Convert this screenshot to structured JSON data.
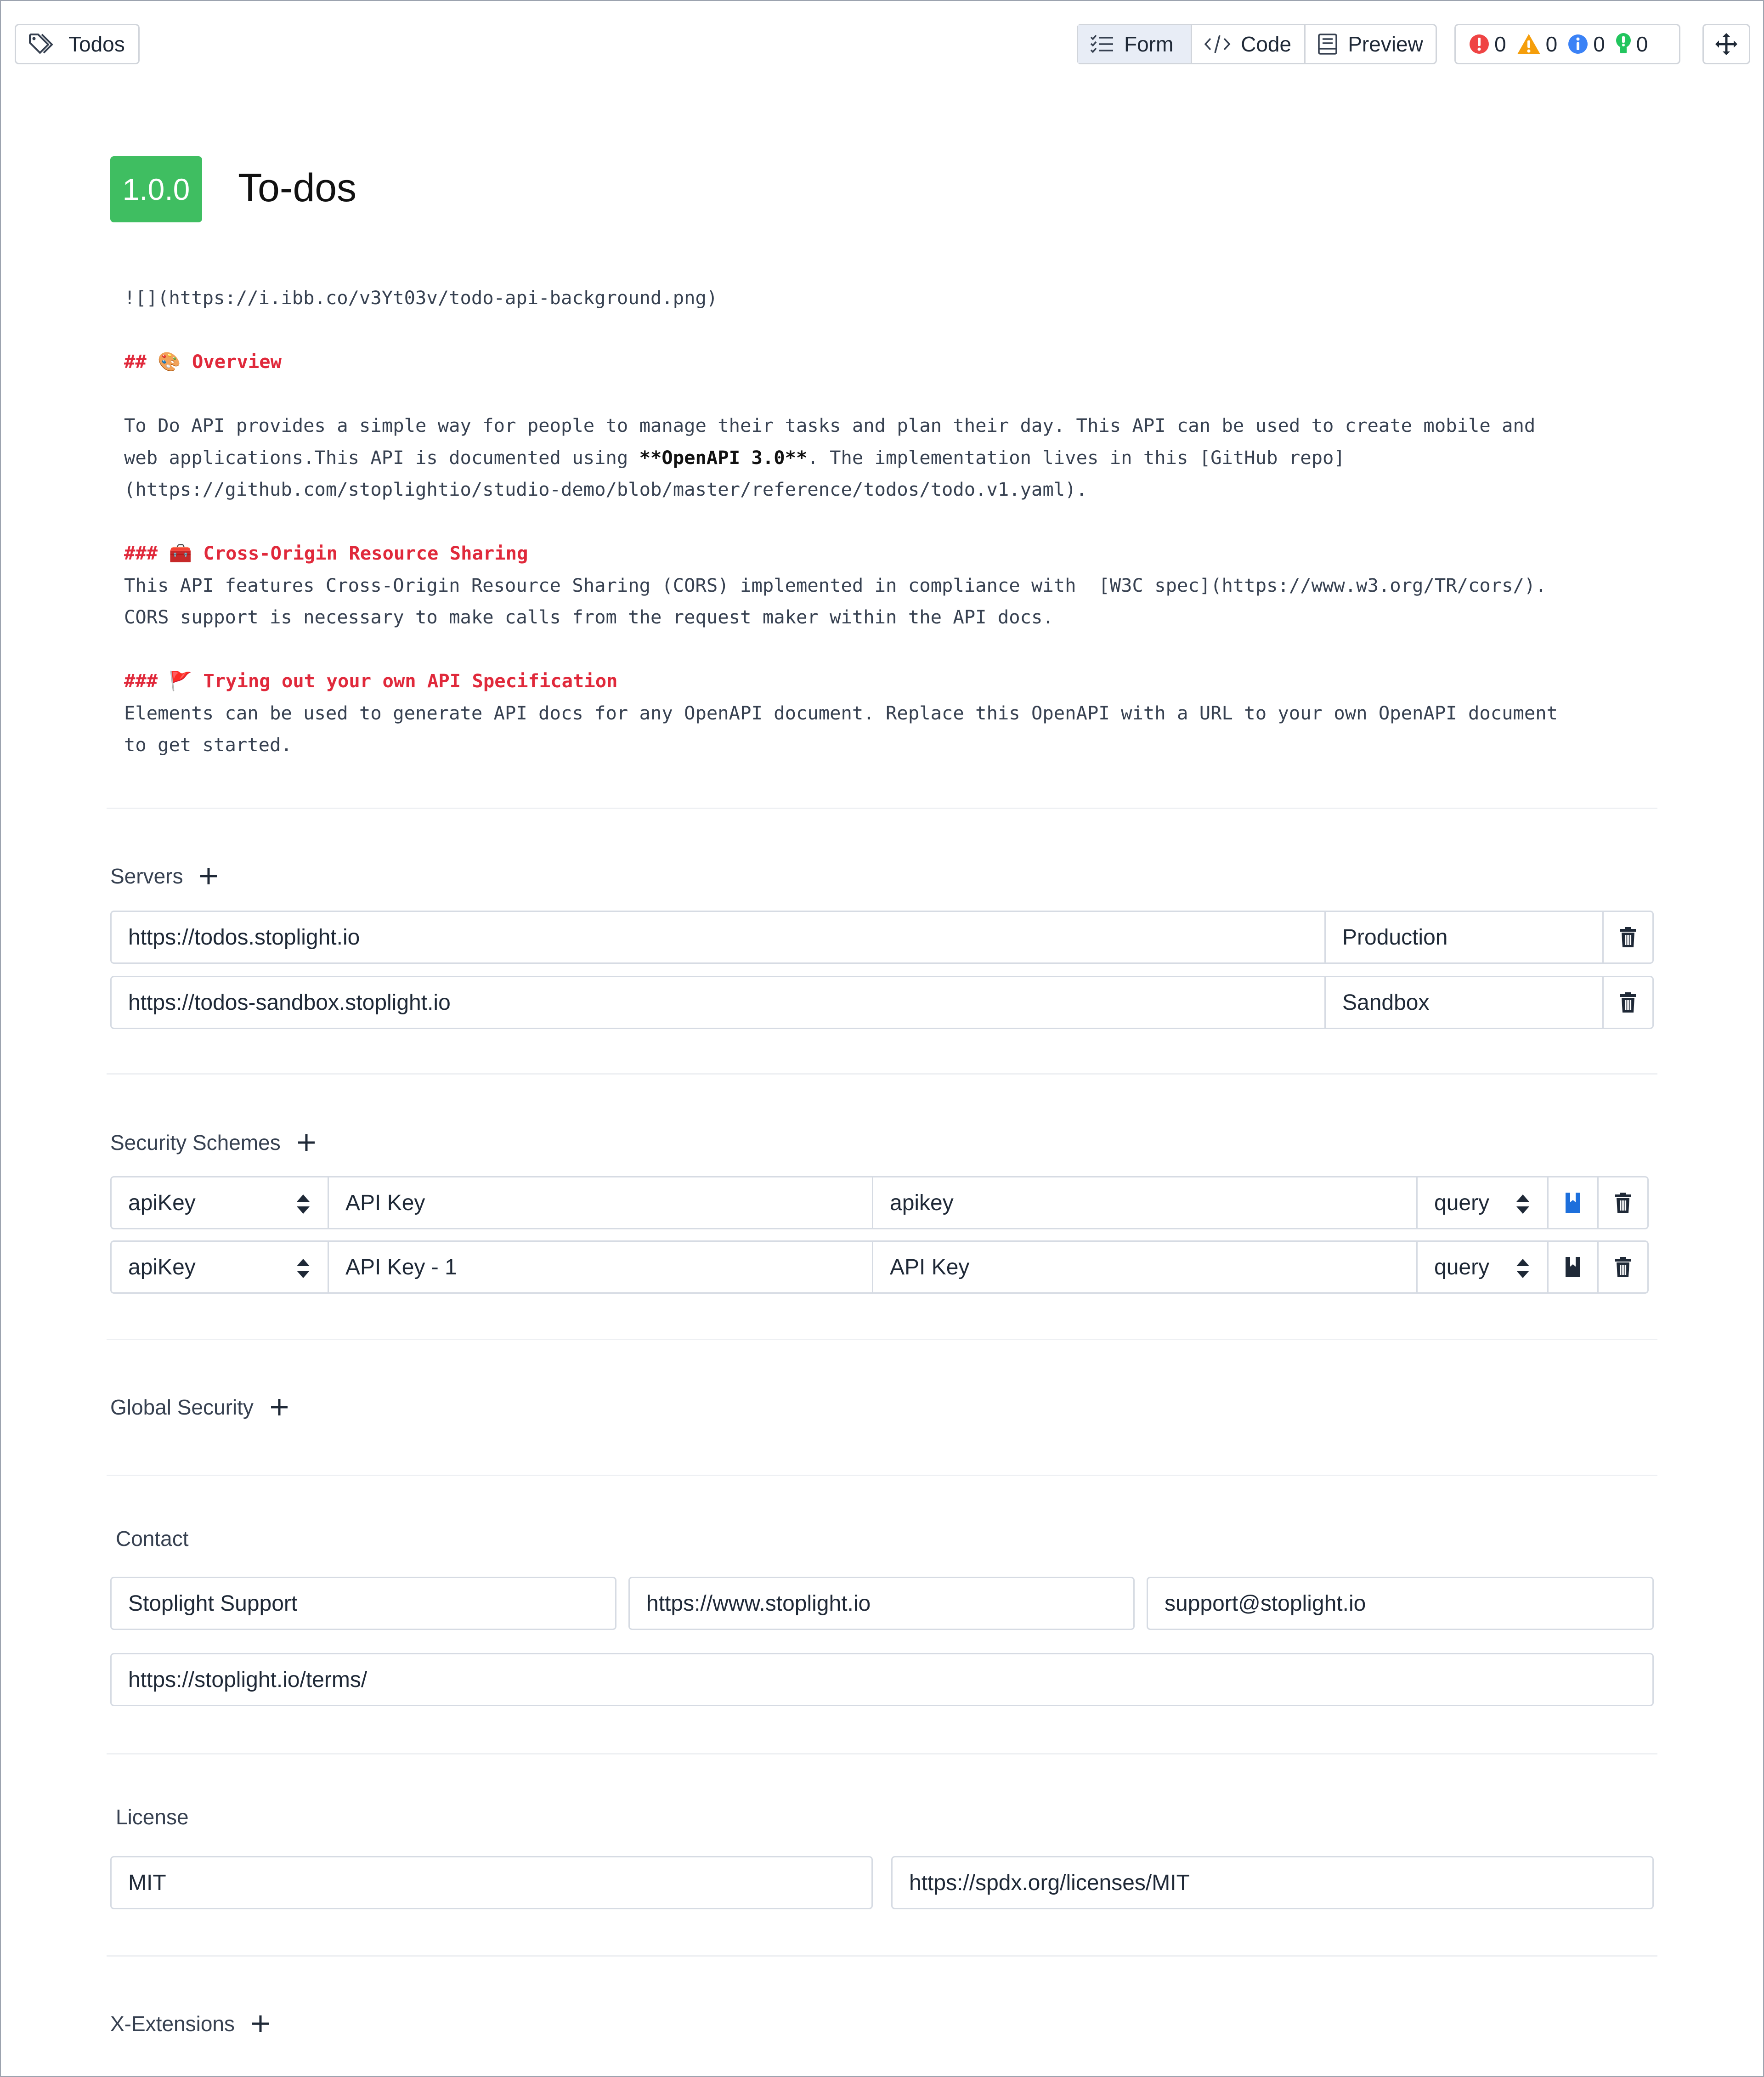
{
  "header": {
    "tag_label": "Todos",
    "modes": [
      "Form",
      "Code",
      "Preview"
    ],
    "active_mode": "Form",
    "diagnostics": {
      "errors": "0",
      "warnings": "0",
      "info": "0",
      "hints": "0"
    }
  },
  "api": {
    "version": "1.0.0",
    "title": "To-dos"
  },
  "description": {
    "image_line": "![](https://i.ibb.co/v3Yt03v/todo-api-background.png)",
    "overview_heading": "## 🎨 Overview",
    "overview_text_1": "To Do API provides a simple way for people to manage their tasks and plan their day. This API can be used to create mobile and",
    "overview_text_2a": "web applications.This API is documented using ",
    "overview_text_2b": "**OpenAPI 3.0**",
    "overview_text_2c": ". The implementation lives in this [GitHub repo]",
    "overview_text_3": "(https://github.com/stoplightio/studio-demo/blob/master/reference/todos/todo.v1.yaml).",
    "cors_heading": "### 🧰 Cross-Origin Resource Sharing",
    "cors_text_1": "This API features Cross-Origin Resource Sharing (CORS) implemented in compliance with  [W3C spec](https://www.w3.org/TR/cors/).",
    "cors_text_2": "CORS support is necessary to make calls from the request maker within the API docs.",
    "own_heading": "### 🚩 Trying out your own API Specification",
    "own_text_1": "Elements can be used to generate API docs for any OpenAPI document. Replace this OpenAPI with a URL to your own OpenAPI document",
    "own_text_2": "to get started."
  },
  "servers": {
    "label": "Servers",
    "items": [
      {
        "url": "https://todos.stoplight.io",
        "name": "Production"
      },
      {
        "url": "https://todos-sandbox.stoplight.io",
        "name": "Sandbox"
      }
    ]
  },
  "security_schemes": {
    "label": "Security Schemes",
    "items": [
      {
        "type": "apiKey",
        "name": "API Key",
        "key": "apikey",
        "in": "query"
      },
      {
        "type": "apiKey",
        "name": "API Key - 1",
        "key": "API Key",
        "in": "query"
      }
    ]
  },
  "global_security": {
    "label": "Global Security"
  },
  "contact": {
    "label": "Contact",
    "name": "Stoplight Support",
    "url": "https://www.stoplight.io",
    "email": "support@stoplight.io",
    "terms": "https://stoplight.io/terms/"
  },
  "license": {
    "label": "License",
    "name": "MIT",
    "url": "https://spdx.org/licenses/MIT"
  },
  "extensions": {
    "label": "X-Extensions"
  },
  "colors": {
    "accent_green": "#3fbe61",
    "heading_red": "#e0293b",
    "error_red": "#ef4444",
    "warning_orange": "#f59e0b",
    "info_blue": "#3b82f6",
    "hint_green": "#22c55e",
    "bookmark_blue": "#1d6fdc"
  }
}
